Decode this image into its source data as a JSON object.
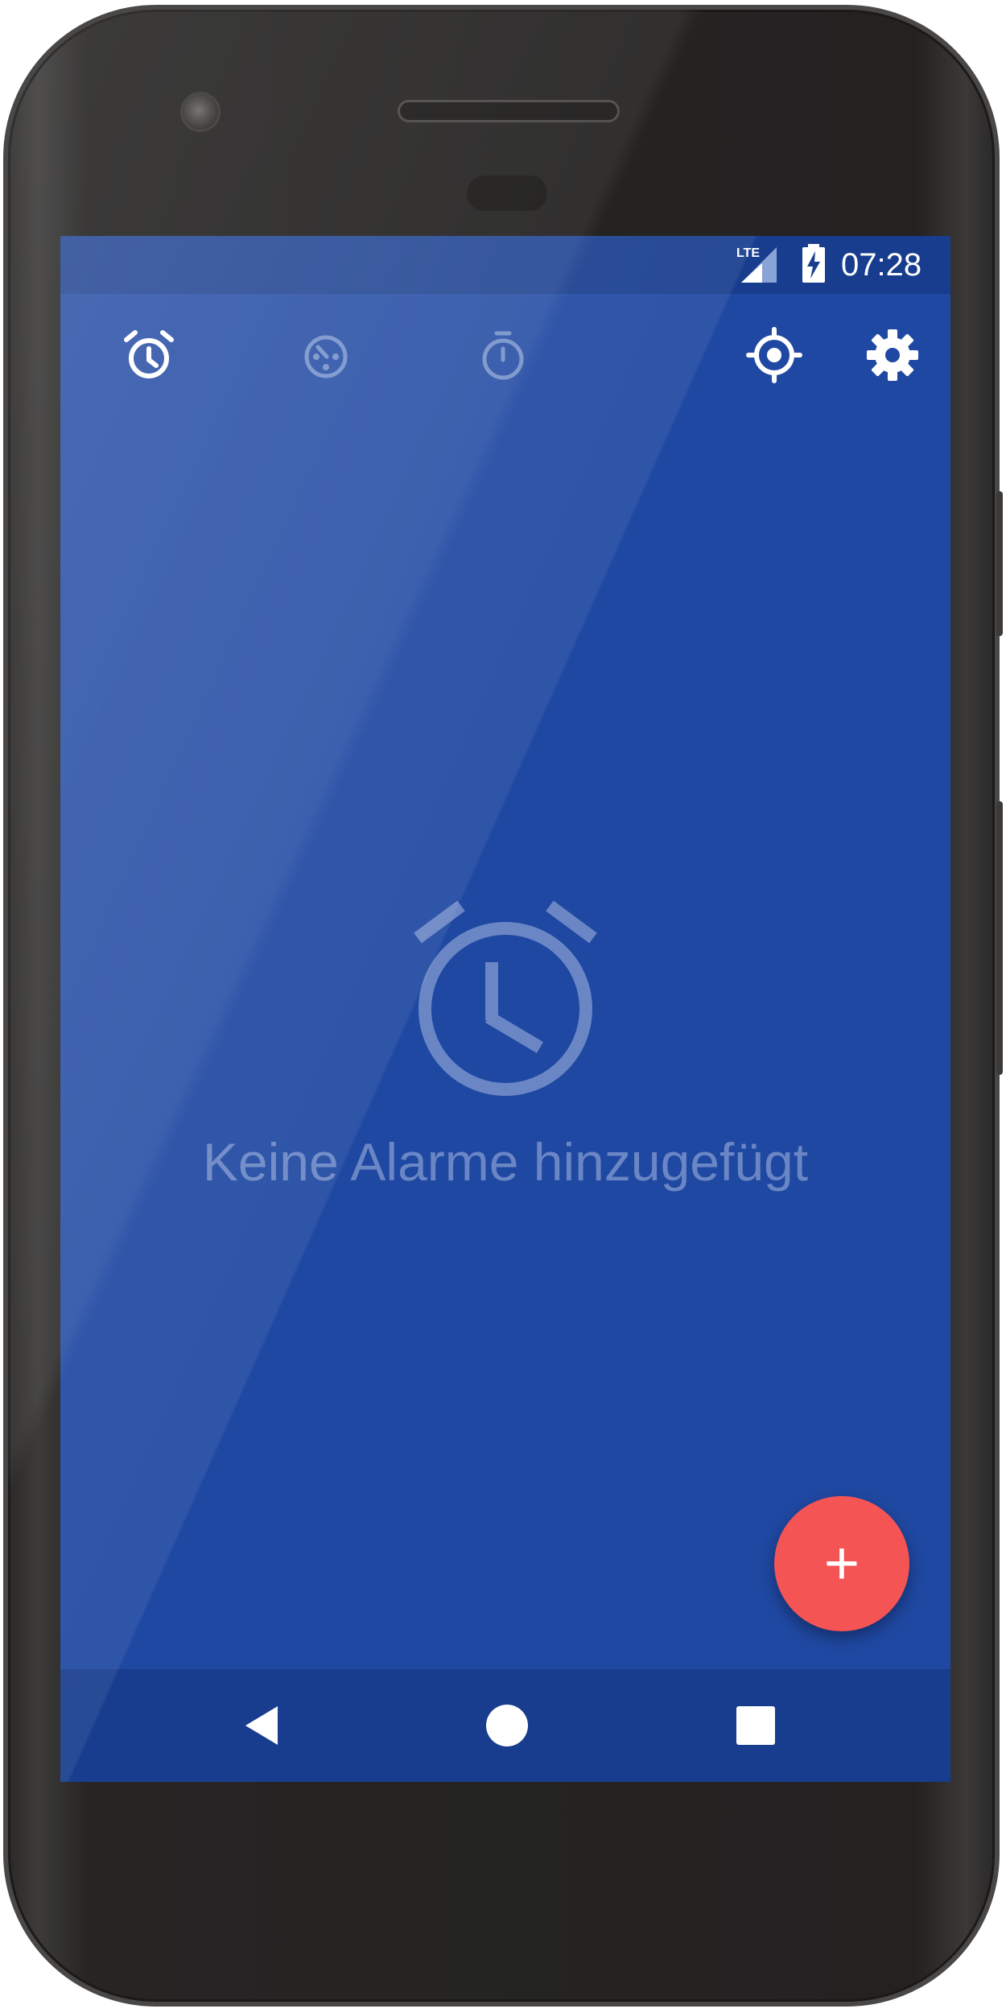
{
  "status_bar": {
    "network_label": "LTE",
    "time": "07:28",
    "icons": [
      "lte-signal-icon",
      "battery-charging-icon"
    ]
  },
  "toolbar": {
    "tabs": [
      {
        "icon": "alarm-icon",
        "active": true
      },
      {
        "icon": "clock-icon",
        "active": false
      },
      {
        "icon": "stopwatch-icon",
        "active": false
      }
    ],
    "actions": [
      {
        "icon": "location-target-icon"
      },
      {
        "icon": "gear-icon"
      }
    ]
  },
  "empty_state": {
    "icon": "alarm-clock-icon",
    "message": "Keine Alarme hinzugefügt"
  },
  "fab": {
    "icon": "plus-icon",
    "label": "+"
  },
  "navigation_bar": {
    "icons": [
      "back-icon",
      "home-icon",
      "recents-icon"
    ]
  },
  "colors": {
    "background": "#1f48a2",
    "status_bar": "#183d8e",
    "fab": "#f55454",
    "empty_text": "#6a86c5"
  }
}
